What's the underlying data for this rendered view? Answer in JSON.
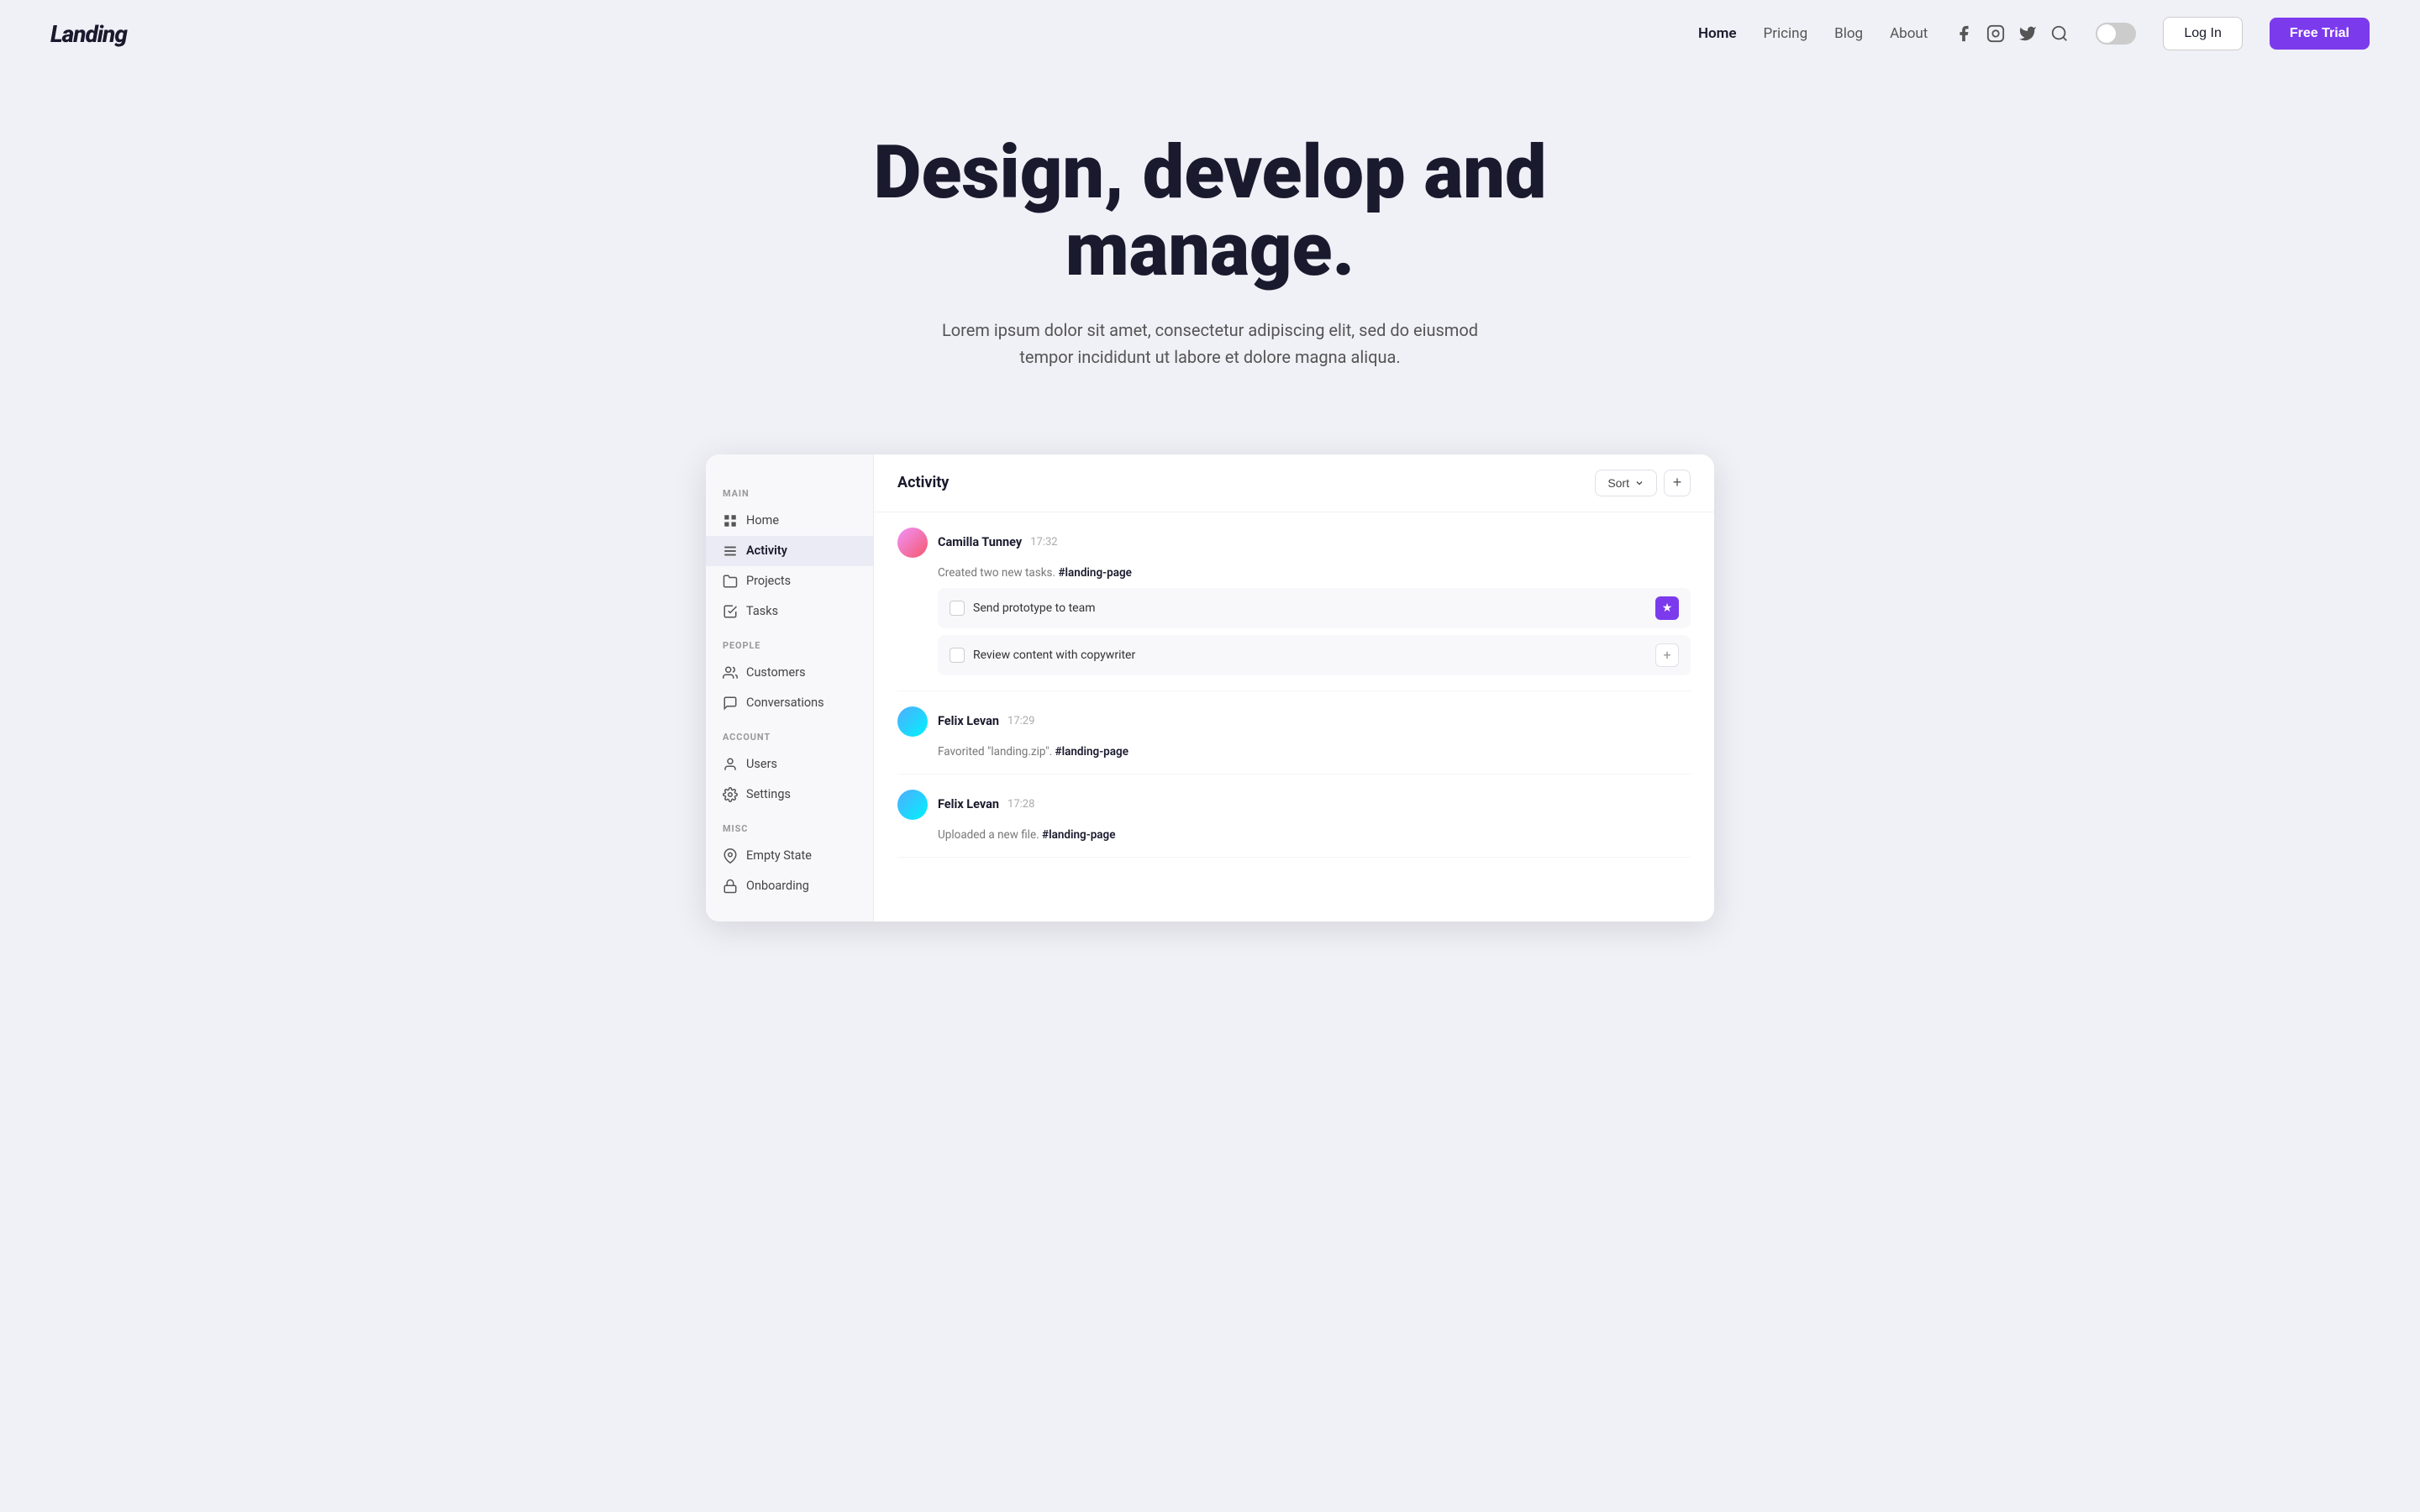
{
  "navbar": {
    "logo": "Landing",
    "links": [
      {
        "label": "Home",
        "active": true
      },
      {
        "label": "Pricing"
      },
      {
        "label": "Blog"
      },
      {
        "label": "About"
      }
    ],
    "login_label": "Log In",
    "free_trial_label": "Free Trial"
  },
  "hero": {
    "title": "Design, develop and manage.",
    "subtitle": "Lorem ipsum dolor sit amet, consectetur adipiscing elit, sed do eiusmod tempor incididunt ut labore et dolore magna aliqua."
  },
  "sidebar": {
    "main_label": "MAIN",
    "main_items": [
      {
        "label": "Home",
        "icon": "grid-icon"
      },
      {
        "label": "Activity",
        "icon": "list-icon",
        "active": true
      },
      {
        "label": "Projects",
        "icon": "folder-icon"
      },
      {
        "label": "Tasks",
        "icon": "check-icon"
      }
    ],
    "people_label": "PEOPLE",
    "people_items": [
      {
        "label": "Customers",
        "icon": "users-icon"
      },
      {
        "label": "Conversations",
        "icon": "chat-icon"
      }
    ],
    "account_label": "ACCOUNT",
    "account_items": [
      {
        "label": "Users",
        "icon": "user-icon"
      },
      {
        "label": "Settings",
        "icon": "gear-icon"
      }
    ],
    "misc_label": "MISC",
    "misc_items": [
      {
        "label": "Empty State",
        "icon": "location-icon"
      },
      {
        "label": "Onboarding",
        "icon": "lock-icon"
      }
    ]
  },
  "activity": {
    "title": "Activity",
    "sort_label": "Sort",
    "add_label": "+",
    "items": [
      {
        "user": "Camilla Tunney",
        "time": "17:32",
        "desc_prefix": "Created two new tasks.",
        "hashtag": "#landing-page",
        "tasks": [
          {
            "label": "Send prototype to team",
            "starred": true
          },
          {
            "label": "Review content with copywriter",
            "starred": false
          }
        ]
      },
      {
        "user": "Felix Levan",
        "time": "17:29",
        "desc_prefix": "Favorited \"landing.zip\".",
        "hashtag": "#landing-page",
        "tasks": []
      },
      {
        "user": "Felix Levan",
        "time": "17:28",
        "desc_prefix": "Uploaded a new file.",
        "hashtag": "#landing-page",
        "tasks": []
      }
    ]
  }
}
